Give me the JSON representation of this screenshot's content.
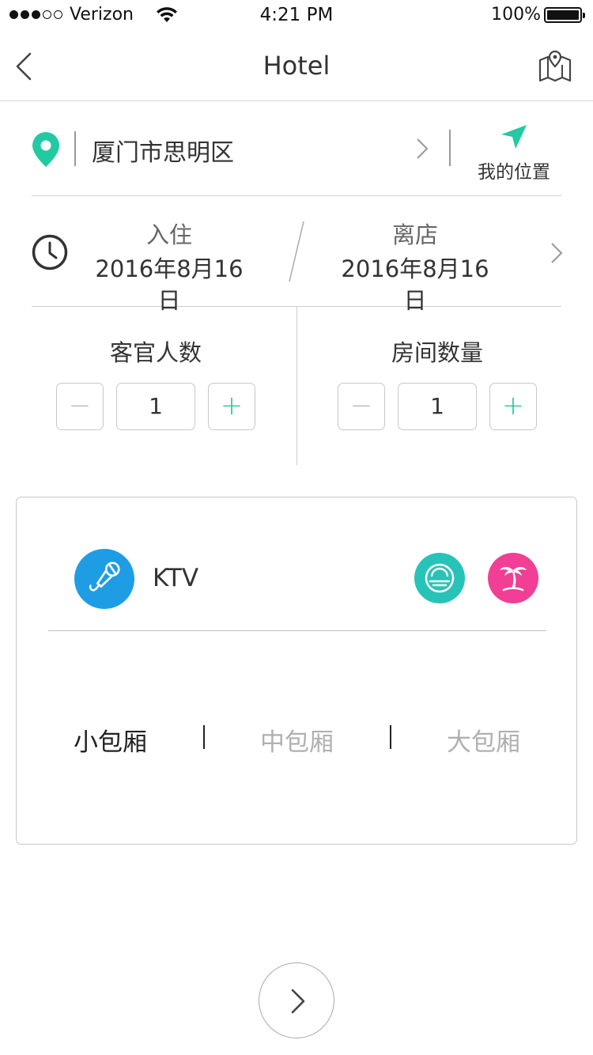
{
  "status_bar": {
    "carrier": "Verizon",
    "time": "4:21 PM",
    "battery": "100%"
  },
  "nav": {
    "title": "Hotel",
    "back_icon": "chevron-left-icon",
    "map_icon": "map-pin-icon"
  },
  "location": {
    "text": "厦门市思明区",
    "my_location_label": "我的位置"
  },
  "dates": {
    "checkin_label": "入住",
    "checkin_value": "2016年8月16日",
    "checkout_label": "离店",
    "checkout_value": "2016年8月16日"
  },
  "counters": {
    "guests_label": "客官人数",
    "guests_value": "1",
    "rooms_label": "房间数量",
    "rooms_value": "1",
    "minus": "−",
    "plus": "+"
  },
  "category": {
    "label": "KTV",
    "rooms": [
      "小包厢",
      "中包厢",
      "大包厢"
    ],
    "selected": "小包厢"
  },
  "colors": {
    "accent_green": "#22c9a3",
    "ktv_blue": "#1e9de4",
    "teal": "#27c3b8",
    "pink": "#f13f95"
  }
}
